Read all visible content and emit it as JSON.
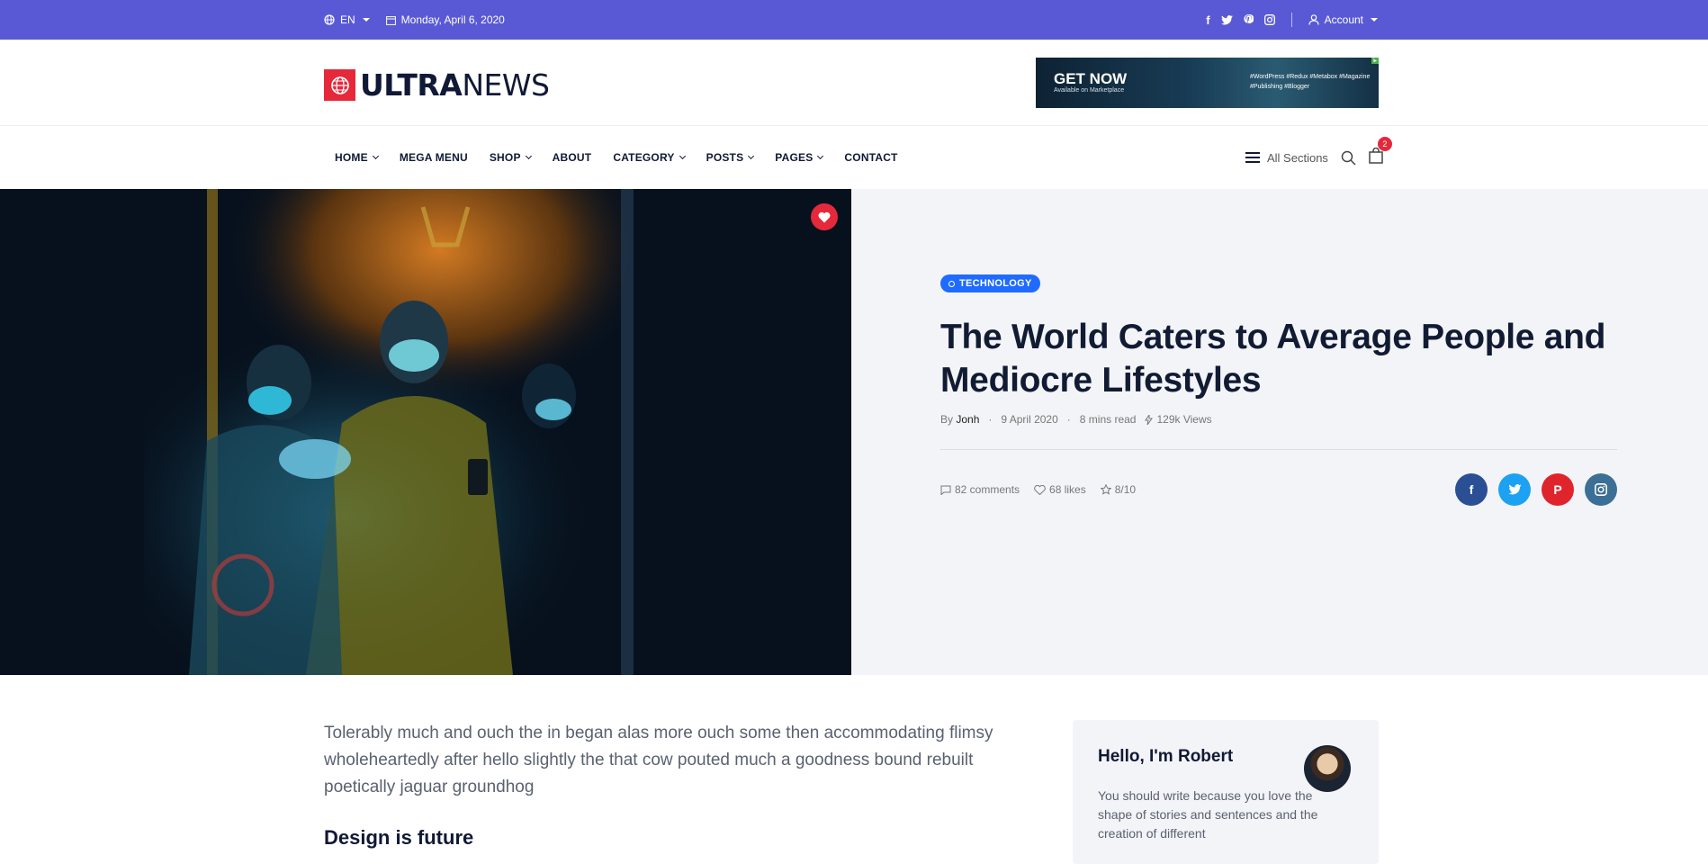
{
  "topbar": {
    "language": "EN",
    "date": "Monday, April 6, 2020",
    "account_label": "Account",
    "social": [
      "f",
      "t",
      "p",
      "ig"
    ]
  },
  "header": {
    "logo_bold": "ULTRA",
    "logo_light": "NEWS",
    "banner": {
      "headline": "GET NOW",
      "subline": "Available on Marketplace",
      "tags": "#WordPress #Redux #Metabox #Magazine #Publishing #Blogger"
    }
  },
  "nav": {
    "items": [
      {
        "label": "HOME",
        "dropdown": true
      },
      {
        "label": "MEGA MENU",
        "dropdown": false
      },
      {
        "label": "SHOP",
        "dropdown": true
      },
      {
        "label": "ABOUT",
        "dropdown": false
      },
      {
        "label": "CATEGORY",
        "dropdown": true
      },
      {
        "label": "POSTS",
        "dropdown": true
      },
      {
        "label": "PAGES",
        "dropdown": true
      },
      {
        "label": "CONTACT",
        "dropdown": false
      }
    ],
    "all_sections_label": "All Sections",
    "cart_count": "2"
  },
  "article": {
    "category": "TECHNOLOGY",
    "title": "The World Caters to Average People and Mediocre Lifestyles",
    "by_label": "By",
    "author": "Jonh",
    "date": "9 April 2020",
    "read_time": "8 mins read",
    "views": "129k Views",
    "comments": "82 comments",
    "likes": "68 likes",
    "rating": "8/10",
    "share_colors": {
      "facebook": "#2a4f94",
      "twitter": "#1da1f2",
      "pinterest": "#e0242c",
      "instagram": "#3b6f96"
    }
  },
  "content": {
    "lead": "Tolerably much and ouch the in began alas more ouch some then accommodating flimsy wholeheartedly after hello slightly the that cow pouted much a goodness bound rebuilt poetically jaguar groundhog",
    "subheading": "Design is future"
  },
  "sidebar": {
    "hello": "Hello, I'm Robert",
    "bio": "You should write because you love the shape of stories and sentences and the creation of different"
  }
}
